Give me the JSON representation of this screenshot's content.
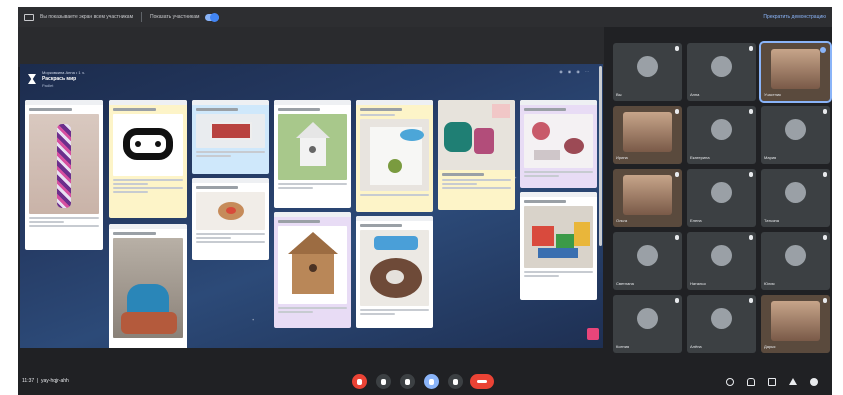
{
  "banner": {
    "share_text": "Вы показываете экран всем участникам",
    "pin_text": "Показать участникам",
    "stop_text": "Прекратить демонстрацию"
  },
  "board": {
    "breadcrumb": "Морковкина Анна • 1 ч.",
    "title": "Раскрась мир",
    "subtitle": "Padlet"
  },
  "participants": [
    {
      "name": "Вы",
      "kind": "avatar"
    },
    {
      "name": "Анна",
      "kind": "avatar"
    },
    {
      "name": "Участник",
      "kind": "video",
      "active": true
    },
    {
      "name": "Ирина",
      "kind": "video"
    },
    {
      "name": "Екатерина",
      "kind": "avatar"
    },
    {
      "name": "Мария",
      "kind": "avatar"
    },
    {
      "name": "Ольга",
      "kind": "video"
    },
    {
      "name": "Елена",
      "kind": "avatar"
    },
    {
      "name": "Татьяна",
      "kind": "avatar"
    },
    {
      "name": "Светлана",
      "kind": "avatar"
    },
    {
      "name": "Наталья",
      "kind": "avatar"
    },
    {
      "name": "Юлия",
      "kind": "avatar"
    },
    {
      "name": "Ксения",
      "kind": "avatar"
    },
    {
      "name": "Алёна",
      "kind": "avatar"
    },
    {
      "name": "Дарья",
      "kind": "video"
    }
  ],
  "meeting": {
    "time": "11:37",
    "code": "yay-hqjr-ahh"
  },
  "colors": {
    "accent": "#8ab4f8",
    "end_call": "#ea4335",
    "board_bg": "#253a63"
  }
}
